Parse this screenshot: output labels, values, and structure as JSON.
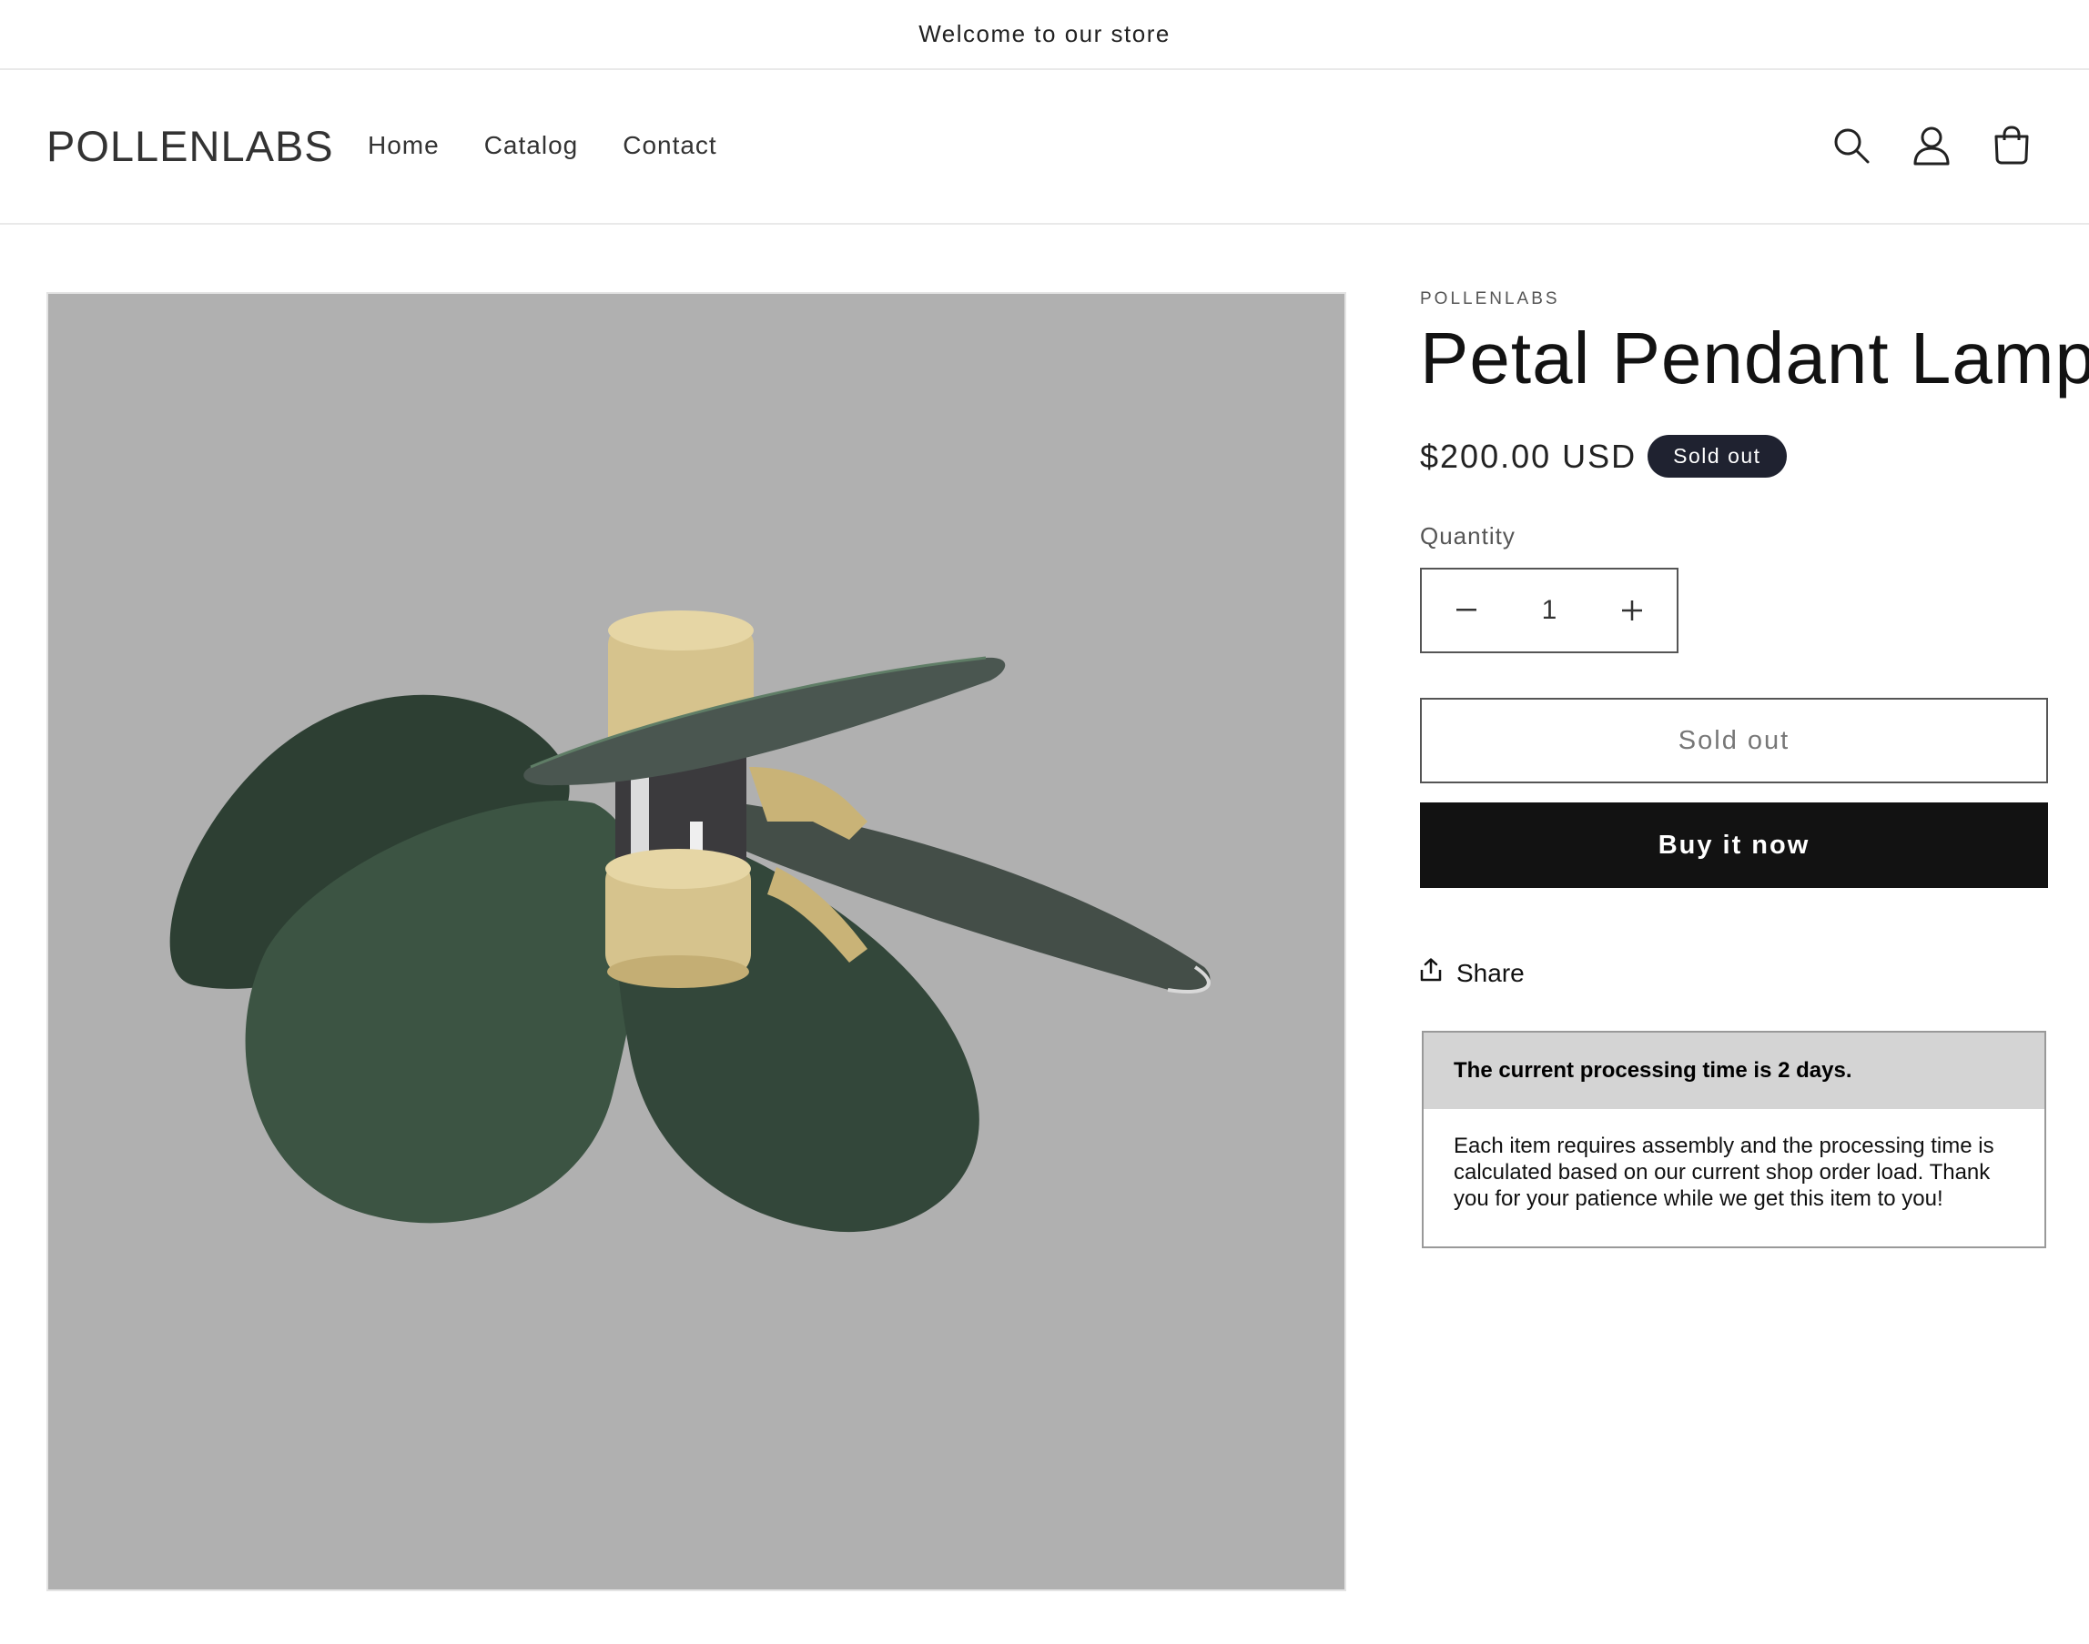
{
  "announcement": {
    "text": "Welcome to our store"
  },
  "header": {
    "logo": "POLLENLABS",
    "nav": [
      {
        "label": "Home"
      },
      {
        "label": "Catalog"
      },
      {
        "label": "Contact"
      }
    ],
    "icons": [
      "search-icon",
      "account-icon",
      "cart-icon"
    ]
  },
  "product": {
    "image_alt": "Petal Pendant Lamp",
    "vendor": "POLLENLABS",
    "title": "Petal Pendant Lamp",
    "price": "$200.00 USD",
    "badge": "Sold out",
    "quantity_label": "Quantity",
    "quantity_value": "1",
    "sold_out_button": "Sold out",
    "buy_now_button": "Buy it now",
    "share_label": "Share",
    "notice": {
      "heading": "The current processing time is 2 days.",
      "body": "Each item requires assembly and the processing time is calculated based on our current shop order load. Thank you for your patience while we get this item to you!"
    }
  },
  "colors": {
    "media_background": "#b0b0b0",
    "petal_green": "#2f4a38",
    "brass": "#d9c48e",
    "badge_background": "#1f2230",
    "buy_button": "#121212"
  }
}
